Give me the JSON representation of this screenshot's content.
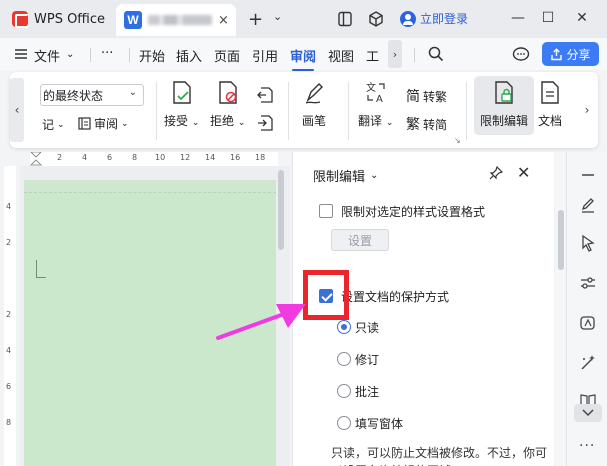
{
  "titlebar": {
    "app_title": "WPS Office",
    "doc_logo_letter": "W",
    "tab_close": "×",
    "new_tab": "+",
    "tab_dropdown": "⌄",
    "login_label": "立即登录",
    "minimize": "—",
    "maximize": "☐",
    "close": "✕"
  },
  "menubar": {
    "file_label": "文件",
    "file_caret": "⌄",
    "more": "···",
    "items": [
      "开始",
      "插入",
      "页面",
      "引用",
      "审阅",
      "视图",
      "工"
    ],
    "active_index": 4,
    "scroll_arrow": "›",
    "share_label": "分享"
  },
  "ribbon": {
    "display_select": "的最终状态",
    "select_caret": "⌄",
    "markup_label": "记",
    "review_pane_label": "审阅",
    "accept_label": "接受",
    "reject_label": "拒绝",
    "pen_label": "画笔",
    "translate_label": "翻译",
    "to_traditional_label": "转繁",
    "to_simplified_label": "转简",
    "restrict_label": "限制编辑",
    "doc_compare_label": "文档",
    "left_arrow": "‹",
    "right_arrow": "›",
    "dropdown_caret": "⌄"
  },
  "ruler": {
    "h_ticks": [
      "2",
      "4",
      "6",
      "8",
      "10",
      "12",
      "14",
      "16",
      "18"
    ],
    "v_ticks": [
      "4",
      "2",
      "2",
      "4",
      "6",
      "8"
    ]
  },
  "panel": {
    "title": "限制编辑",
    "title_caret": "⌄",
    "close": "✕",
    "format_restrict_label": "限制对选定的样式设置格式",
    "format_restrict_checked": false,
    "settings_button": "设置",
    "protect_label": "设置文档的保护方式",
    "protect_checked": true,
    "options": [
      {
        "label": "只读",
        "selected": true
      },
      {
        "label": "修订",
        "selected": false
      },
      {
        "label": "批注",
        "selected": false
      },
      {
        "label": "填写窗体",
        "selected": false
      }
    ],
    "description": "只读，可以防止文档被修改。不过，你可以设置允许编辑的区域。"
  },
  "sidebar": {
    "more": "···"
  },
  "colors": {
    "accent": "#2c5fd6",
    "share_bg": "#3b7cf5",
    "highlight_box": "#e8262b",
    "annotation_arrow": "#f03be0",
    "doc_page_bg": "#cce8cc"
  }
}
